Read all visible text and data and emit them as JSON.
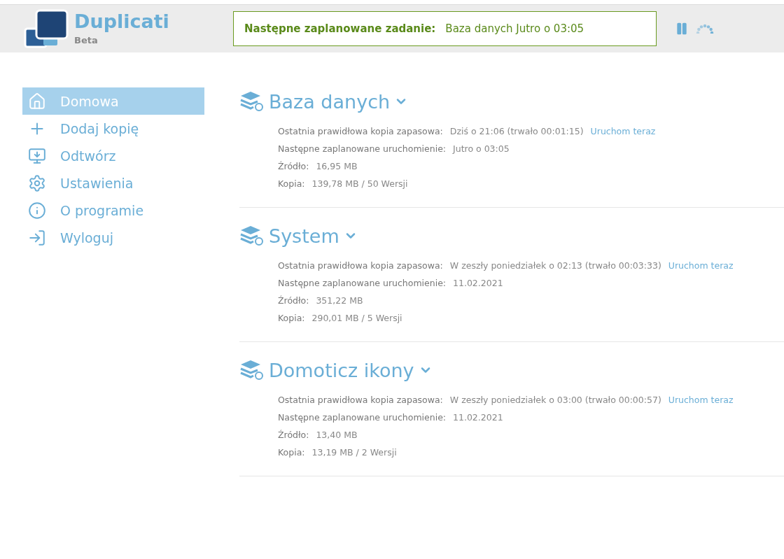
{
  "header": {
    "app_name": "Duplicati",
    "app_subtitle": "Beta",
    "status": {
      "label": "Następne zaplanowane zadanie:",
      "value": "Baza danych Jutro o 03:05"
    }
  },
  "sidebar": {
    "items": [
      {
        "kind": "home",
        "label": "Domowa",
        "selected": true
      },
      {
        "kind": "add",
        "label": "Dodaj kopię",
        "selected": false
      },
      {
        "kind": "restore",
        "label": "Odtwórz",
        "selected": false
      },
      {
        "kind": "settings",
        "label": "Ustawienia",
        "selected": false
      },
      {
        "kind": "about",
        "label": "O programie",
        "selected": false
      },
      {
        "kind": "logout",
        "label": "Wyloguj",
        "selected": false
      }
    ]
  },
  "jobs": [
    {
      "name": "Baza danych",
      "rows": [
        {
          "label": "Ostatnia prawidłowa kopia zapasowa:",
          "value": "Dziś o 21:06 (trwało 00:01:15)",
          "action": "Uruchom teraz"
        },
        {
          "label": "Następne zaplanowane uruchomienie:",
          "value": "Jutro o 03:05"
        },
        {
          "label": "Źródło:",
          "value": "16,95 MB"
        },
        {
          "label": "Kopia:",
          "value": "139,78 MB / 50 Wersji"
        }
      ]
    },
    {
      "name": "System",
      "rows": [
        {
          "label": "Ostatnia prawidłowa kopia zapasowa:",
          "value": "W zeszły poniedziałek o 02:13 (trwało 00:03:33)",
          "action": "Uruchom teraz"
        },
        {
          "label": "Następne zaplanowane uruchomienie:",
          "value": "11.02.2021"
        },
        {
          "label": "Źródło:",
          "value": "351,22 MB"
        },
        {
          "label": "Kopia:",
          "value": "290,01 MB / 5 Wersji"
        }
      ]
    },
    {
      "name": "Domoticz ikony",
      "rows": [
        {
          "label": "Ostatnia prawidłowa kopia zapasowa:",
          "value": "W zeszły poniedziałek o 03:00 (trwało 00:00:57)",
          "action": "Uruchom teraz"
        },
        {
          "label": "Następne zaplanowane uruchomienie:",
          "value": "11.02.2021"
        },
        {
          "label": "Źródło:",
          "value": "13,40 MB"
        },
        {
          "label": "Kopia:",
          "value": "13,19 MB / 2 Wersji"
        }
      ]
    }
  ]
}
